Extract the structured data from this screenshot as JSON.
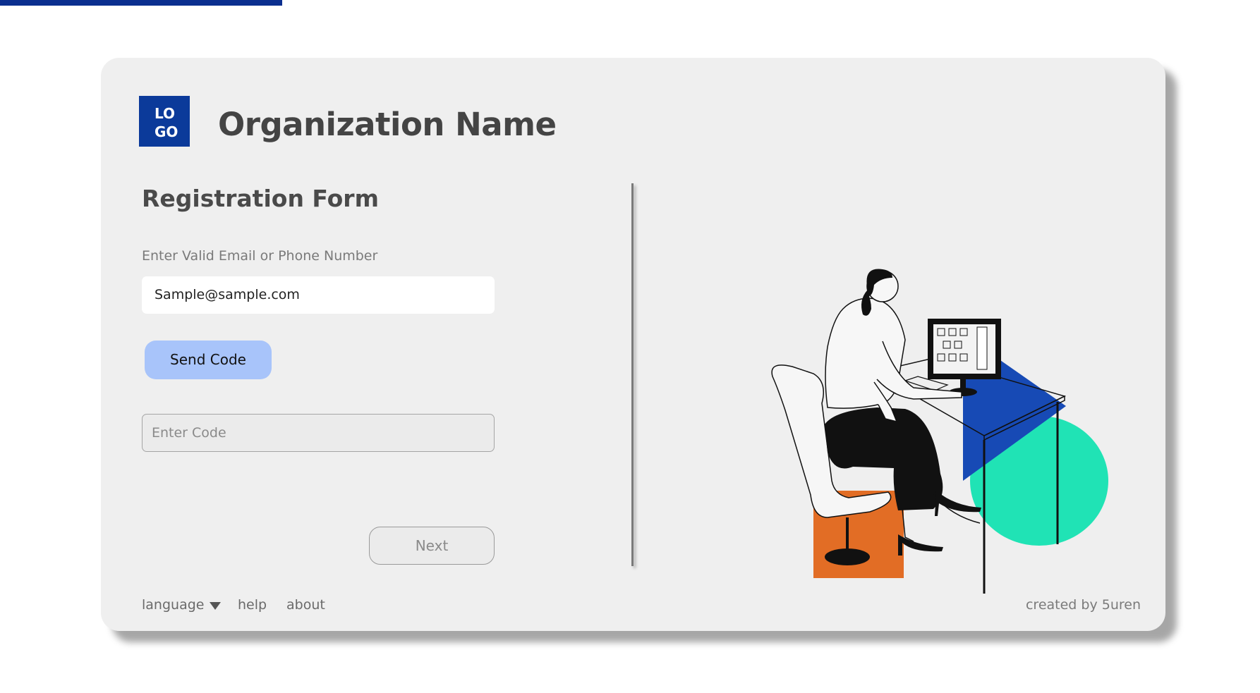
{
  "colors": {
    "accent_bar": "#0b2f8f",
    "logo_bg": "#0b3a9a",
    "send_button_bg": "#a8c4fa",
    "card_bg": "#efefef"
  },
  "header": {
    "logo_line1": "LO",
    "logo_line2": "GO",
    "org_name": "Organization Name"
  },
  "form": {
    "title": "Registration Form",
    "email_label": "Enter Valid Email or Phone Number",
    "email_value": "Sample@sample.com",
    "send_code_label": "Send Code",
    "code_placeholder": "Enter Code",
    "next_label": "Next"
  },
  "footer": {
    "language_label": "language",
    "language_icon": "triangle-down-icon",
    "help_label": "help",
    "about_label": "about",
    "credit": "created by 5uren"
  },
  "illustration": {
    "icon": "woman-at-computer-illustration"
  }
}
